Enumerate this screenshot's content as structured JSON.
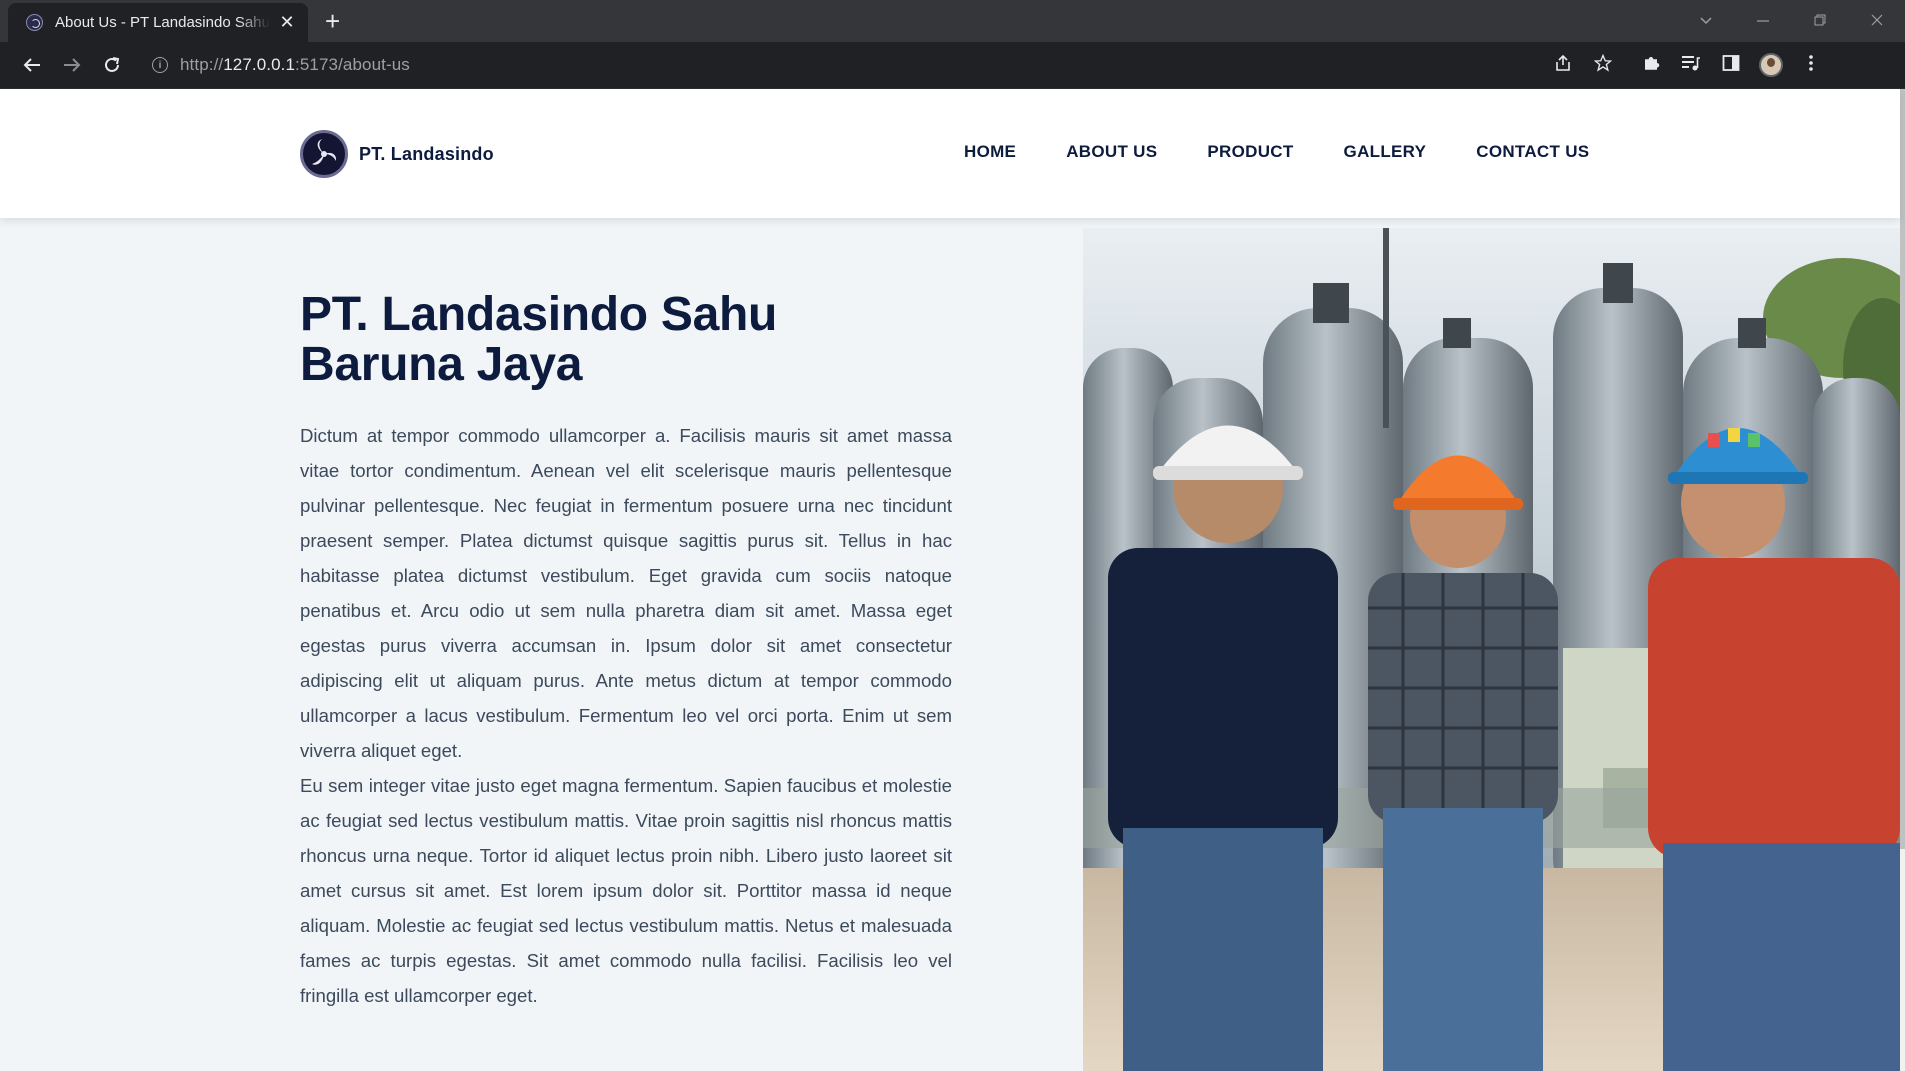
{
  "browser": {
    "tab_title": "About Us - PT Landasindo Sahu Baruna Jaya",
    "tab_close": "✕",
    "new_tab": "+",
    "url_scheme": "http://",
    "url_host": "127.0.0.1",
    "url_rest": ":5173/about-us"
  },
  "site": {
    "brand_name": "PT. Landasindo",
    "nav": [
      "HOME",
      "ABOUT US",
      "PRODUCT",
      "GALLERY",
      "CONTACT US"
    ]
  },
  "about": {
    "title": "PT. Landasindo Sahu Baruna Jaya",
    "paragraphs": [
      "Dictum at tempor commodo ullamcorper a. Facilisis mauris sit amet massa vitae tortor condimentum. Aenean vel elit scelerisque mauris pellentesque pulvinar pellentesque. Nec feugiat in fermentum posuere urna nec tincidunt praesent semper. Platea dictumst quisque sagittis purus sit. Tellus in hac habitasse platea dictumst vestibulum. Eget gravida cum sociis natoque penatibus et. Arcu odio ut sem nulla pharetra diam sit amet. Massa eget egestas purus viverra accumsan in. Ipsum dolor sit amet consectetur adipiscing elit ut aliquam purus. Ante metus dictum at tempor commodo ullamcorper a lacus vestibulum. Fermentum leo vel orci porta. Enim ut sem viverra aliquet eget.",
      "Eu sem integer vitae justo eget magna fermentum. Sapien faucibus et molestie ac feugiat sed lectus vestibulum mattis. Vitae proin sagittis nisl rhoncus mattis rhoncus urna neque. Tortor id aliquet lectus proin nibh. Libero justo laoreet sit amet cursus sit amet. Est lorem ipsum dolor sit. Porttitor massa id neque aliquam. Molestie ac feugiat sed lectus vestibulum mattis. Netus et malesuada fames ac turpis egestas. Sit amet commodo nulla facilisi. Facilisis leo vel fringilla est ullamcorper eget."
    ]
  },
  "colors": {
    "navy": "#0d1b3e",
    "body_text": "#3c4a5c",
    "page_bg": "#f1f5f8"
  }
}
